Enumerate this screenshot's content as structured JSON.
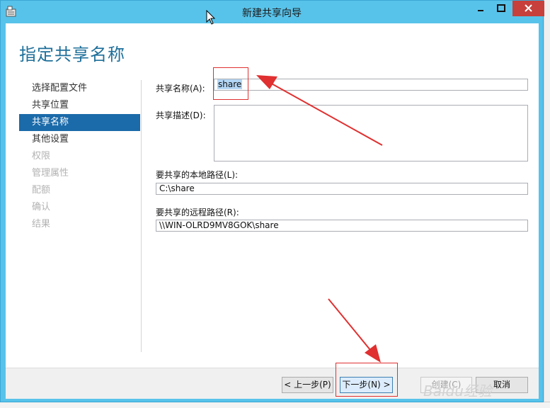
{
  "window": {
    "title": "新建共享向导"
  },
  "page": {
    "title": "指定共享名称"
  },
  "nav": {
    "items": [
      {
        "label": "选择配置文件",
        "state": "normal"
      },
      {
        "label": "共享位置",
        "state": "normal"
      },
      {
        "label": "共享名称",
        "state": "active"
      },
      {
        "label": "其他设置",
        "state": "normal"
      },
      {
        "label": "权限",
        "state": "disabled"
      },
      {
        "label": "管理属性",
        "state": "disabled"
      },
      {
        "label": "配额",
        "state": "disabled"
      },
      {
        "label": "确认",
        "state": "disabled"
      },
      {
        "label": "结果",
        "state": "disabled"
      }
    ]
  },
  "form": {
    "share_name_label": "共享名称(A):",
    "share_name_value": "share",
    "share_desc_label": "共享描述(D):",
    "share_desc_value": "",
    "local_path_label": "要共享的本地路径(L):",
    "local_path_value": "C:\\share",
    "remote_path_label": "要共享的远程路径(R):",
    "remote_path_value": "\\\\WIN-OLRD9MV8GOK\\share"
  },
  "buttons": {
    "prev": "< 上一步(P)",
    "next": "下一步(N) >",
    "create": "创建(C)",
    "cancel": "取消"
  },
  "watermark": "Baidu经验",
  "colors": {
    "title_bar": "#58c3ea",
    "active_nav": "#1b6aa9",
    "page_title": "#1e6f9a",
    "annotation": "#e03030",
    "close_button": "#c7403b"
  }
}
